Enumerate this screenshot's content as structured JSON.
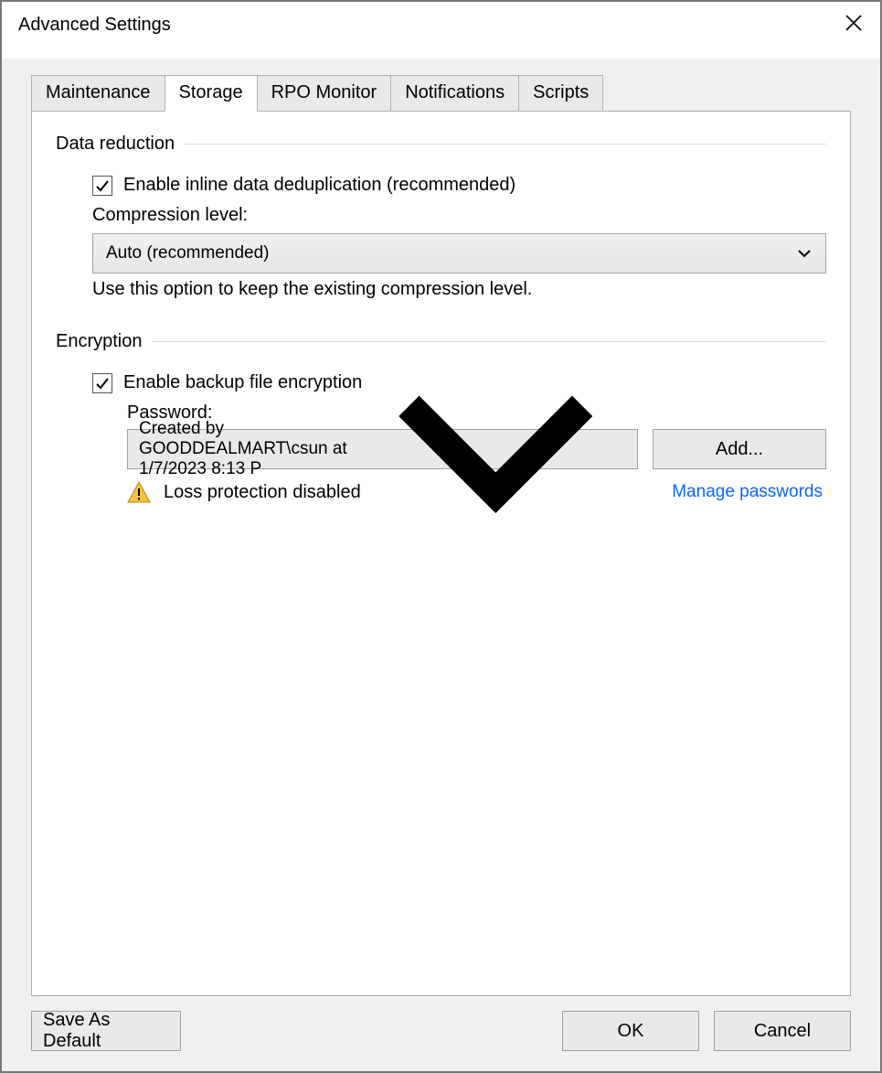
{
  "window": {
    "title": "Advanced Settings"
  },
  "tabs": {
    "maintenance": "Maintenance",
    "storage": "Storage",
    "rpo_monitor": "RPO Monitor",
    "notifications": "Notifications",
    "scripts": "Scripts"
  },
  "data_reduction": {
    "legend": "Data reduction",
    "dedup_label": "Enable inline data deduplication (recommended)",
    "dedup_checked": true,
    "compression_label": "Compression level:",
    "compression_value": "Auto (recommended)",
    "compression_hint": "Use this option to keep the existing compression level."
  },
  "encryption": {
    "legend": "Encryption",
    "enable_label": "Enable backup file encryption",
    "enable_checked": true,
    "password_label": "Password:",
    "password_value": "Created by GOODDEALMART\\csun at 1/7/2023 8:13 P",
    "add_label": "Add...",
    "warning_text": "Loss protection disabled",
    "manage_link": "Manage passwords"
  },
  "footer": {
    "save_default": "Save As Default",
    "ok": "OK",
    "cancel": "Cancel"
  }
}
